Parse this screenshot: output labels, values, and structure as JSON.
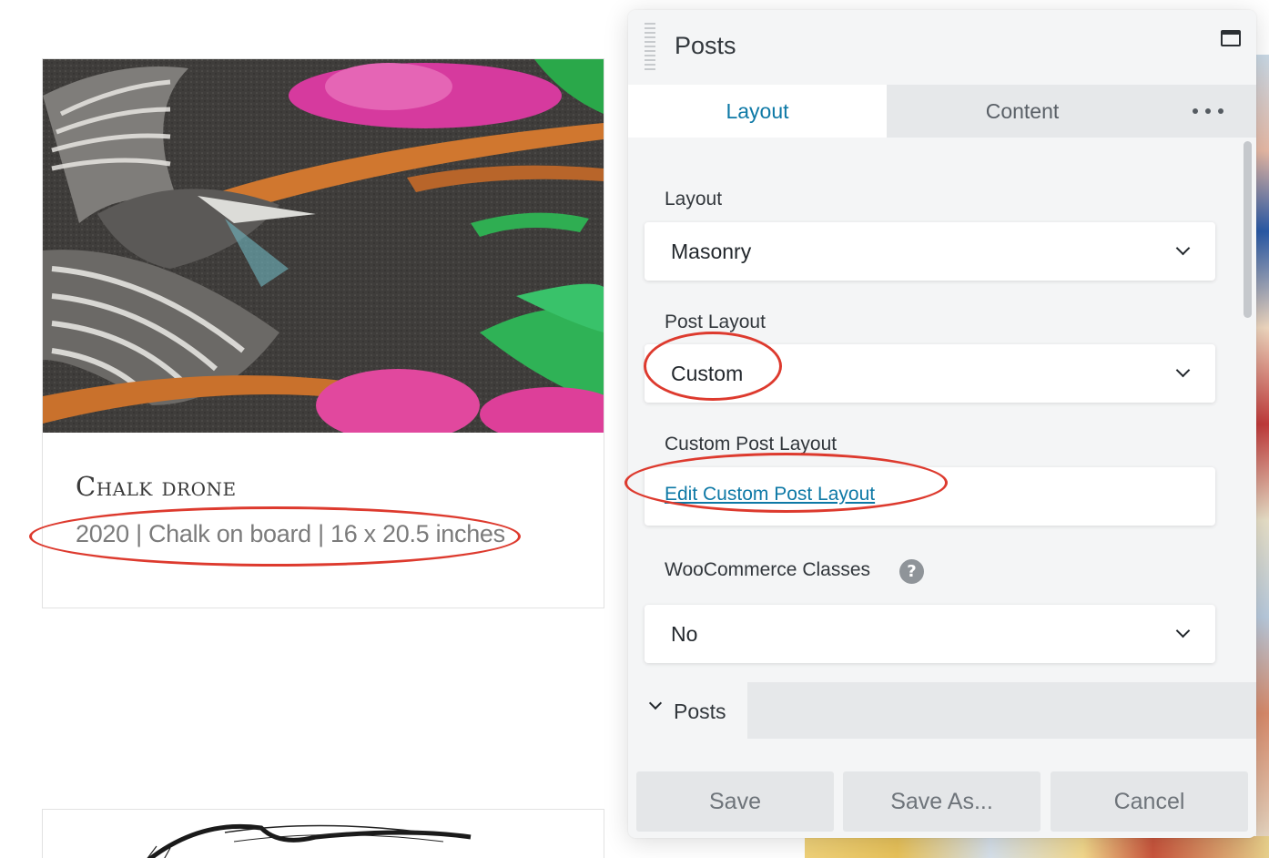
{
  "post": {
    "title": "Chalk drone",
    "meta": "2020 | Chalk on board | 16 x 20.5 inches",
    "image_subject": "chalk drawing of a hummingbird with pink flowers"
  },
  "panel": {
    "title": "Posts",
    "tabs": [
      {
        "label": "Layout",
        "active": true
      },
      {
        "label": "Content",
        "active": false
      }
    ],
    "fields": {
      "layout": {
        "label": "Layout",
        "value": "Masonry"
      },
      "post_layout": {
        "label": "Post Layout",
        "value": "Custom"
      },
      "custom_post_layout": {
        "label": "Custom Post Layout",
        "link": "Edit Custom Post Layout"
      },
      "woocommerce_classes": {
        "label": "WooCommerce Classes",
        "value": "No",
        "help": "?"
      }
    },
    "section": {
      "label": "Posts"
    },
    "buttons": {
      "save": "Save",
      "save_as": "Save As...",
      "cancel": "Cancel"
    }
  },
  "colors": {
    "accent": "#0e79a6",
    "annotation": "#dd3a2e",
    "panel_bg": "#f4f5f6",
    "tab_inactive_bg": "#e6e8ea",
    "button_bg": "#e4e6e8"
  },
  "icons": [
    "drag-handle-icon",
    "maximize-icon",
    "more-icon",
    "chevron-down-icon",
    "help-icon"
  ]
}
